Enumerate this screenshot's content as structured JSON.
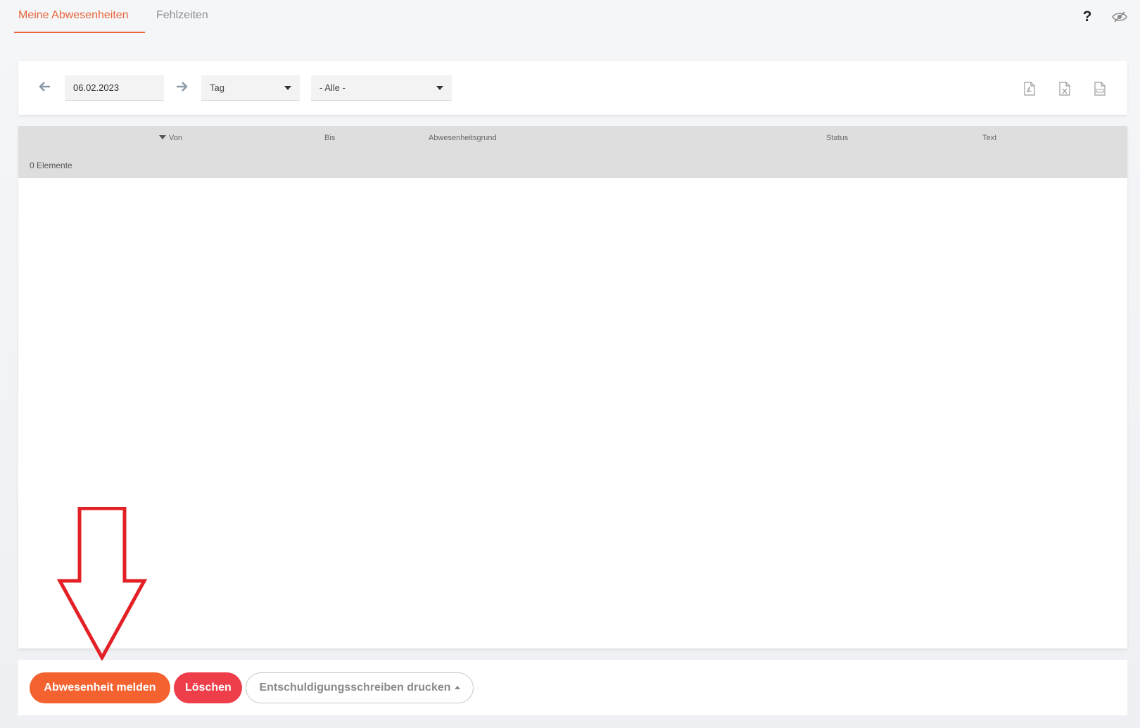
{
  "tabs": [
    {
      "label": "Meine Abwesenheiten",
      "active": true
    },
    {
      "label": "Fehlzeiten",
      "active": false
    }
  ],
  "header_icons": {
    "help": "question-mark",
    "visibility": "eye-slash"
  },
  "toolbar": {
    "date_value": "06.02.2023",
    "period_select": "Tag",
    "filter_select": "- Alle -",
    "exports": [
      "pdf",
      "xls",
      "csv"
    ]
  },
  "table": {
    "columns": {
      "von": "Von",
      "bis": "Bis",
      "grund": "Abwesenheitsgrund",
      "status": "Status",
      "text": "Text"
    },
    "count_label": "0 Elemente"
  },
  "footer": {
    "report_label": "Abwesenheit melden",
    "delete_label": "Löschen",
    "print_label": "Entschuldigungsschreiben drucken"
  },
  "colors": {
    "accent": "#e8643a",
    "report_button": "#f4622f",
    "delete_button": "#ee3e4a",
    "annotation_arrow": "#e32026"
  }
}
